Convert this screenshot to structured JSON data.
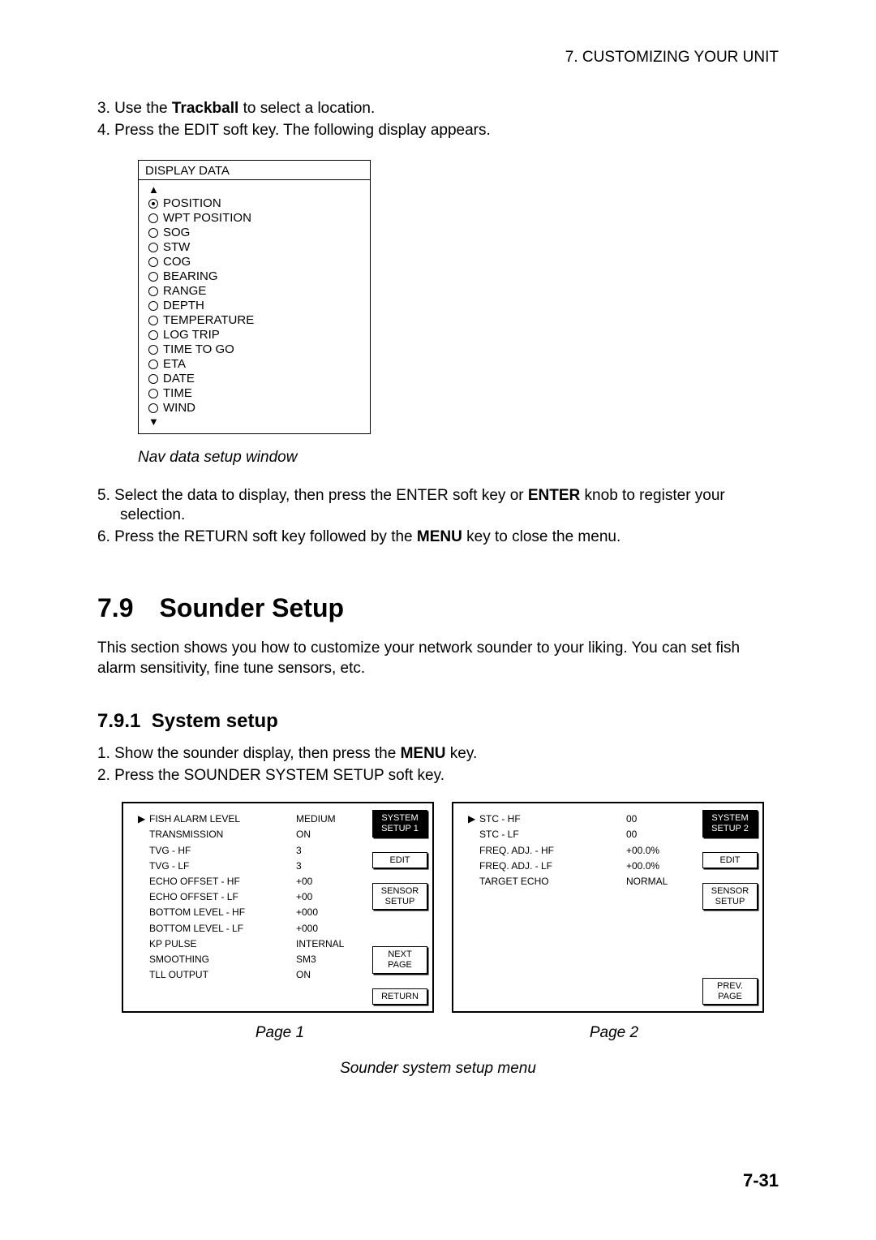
{
  "header": "7. CUSTOMIZING YOUR UNIT",
  "steps_top": {
    "s3_pre": "Use the ",
    "s3_bold": "Trackball",
    "s3_post": " to select a location.",
    "s4": "Press the EDIT soft key. The following display appears."
  },
  "display_data": {
    "title": "DISPLAY DATA",
    "items": [
      "POSITION",
      "WPT POSITION",
      "SOG",
      "STW",
      "COG",
      "BEARING",
      "RANGE",
      "DEPTH",
      "TEMPERATURE",
      "LOG TRIP",
      "TIME TO GO",
      "ETA",
      "DATE",
      "TIME",
      "WIND"
    ],
    "selected_index": 0
  },
  "nav_caption": "Nav data setup window",
  "steps_5_6": {
    "s5_pre": "Select the data to display, then press the ENTER soft key or ",
    "s5_bold": "ENTER",
    "s5_post": " knob to register your selection.",
    "s6_pre": "Press the RETURN soft key followed by the ",
    "s6_bold": "MENU",
    "s6_post": " key to close the menu."
  },
  "section_79": {
    "heading": "7.9 Sounder Setup",
    "para": "This section shows you how to customize your network sounder to your liking. You can set fish alarm sensitivity, fine tune sensors, etc."
  },
  "section_791": {
    "heading": "7.9.1  System setup",
    "s1_pre": "Show the sounder display, then press the ",
    "s1_bold": "MENU",
    "s1_post": " key.",
    "s2": "Press the SOUNDER SYSTEM SETUP soft key."
  },
  "menu1": {
    "items": [
      {
        "label": "FISH ALARM LEVEL",
        "value": "MEDIUM",
        "arrow": true
      },
      {
        "label": "TRANSMISSION",
        "value": "ON"
      },
      {
        "label": "TVG - HF",
        "value": "3"
      },
      {
        "label": "TVG - LF",
        "value": "3"
      },
      {
        "label": "ECHO OFFSET - HF",
        "value": "+00"
      },
      {
        "label": "ECHO OFFSET - LF",
        "value": "+00"
      },
      {
        "label": "BOTTOM LEVEL - HF",
        "value": "+000"
      },
      {
        "label": "BOTTOM LEVEL - LF",
        "value": "+000"
      },
      {
        "label": "KP PULSE",
        "value": "INTERNAL"
      },
      {
        "label": "SMOOTHING",
        "value": "SM3"
      },
      {
        "label": "TLL OUTPUT",
        "value": "ON"
      }
    ],
    "side": {
      "system_setup": "SYSTEM\nSETUP 1",
      "edit": "EDIT",
      "sensor_setup": "SENSOR\nSETUP",
      "next_page": "NEXT\nPAGE",
      "return": "RETURN"
    }
  },
  "menu2": {
    "items": [
      {
        "label": "STC - HF",
        "value": "00",
        "arrow": true
      },
      {
        "label": "STC - LF",
        "value": "00"
      },
      {
        "label": "FREQ. ADJ. - HF",
        "value": "+00.0%"
      },
      {
        "label": "FREQ. ADJ. - LF",
        "value": "+00.0%"
      },
      {
        "label": "TARGET ECHO",
        "value": "NORMAL"
      }
    ],
    "side": {
      "system_setup": "SYSTEM\nSETUP 2",
      "edit": "EDIT",
      "sensor_setup": "SENSOR\nSETUP",
      "prev_page": "PREV.\nPAGE"
    }
  },
  "page_labels": {
    "p1": "Page 1",
    "p2": "Page 2"
  },
  "menu_caption": "Sounder system setup menu",
  "footer_page": "7-31"
}
